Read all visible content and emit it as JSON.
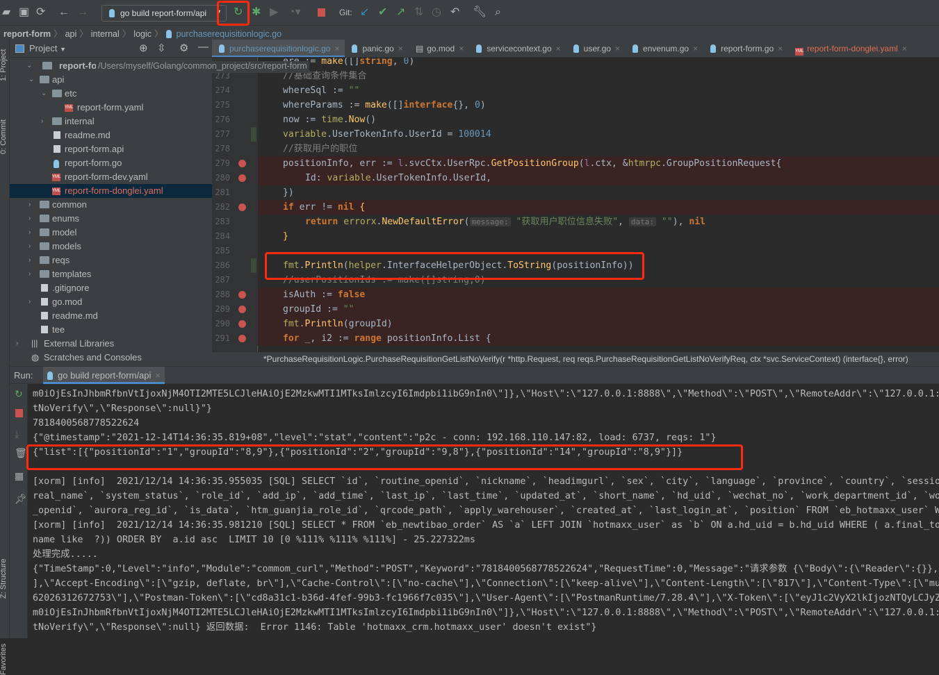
{
  "toolbar": {
    "run_config": "go build report-form/api",
    "git_label": "Git:",
    "icons": [
      "open-folder-icon",
      "save-icon",
      "sync-icon",
      "back-icon",
      "forward-icon",
      "rerun-icon",
      "debug-icon",
      "coverage-icon",
      "profile-icon",
      "stop-icon",
      "git-update-icon",
      "git-commit-icon",
      "git-push-icon",
      "git-compare-icon",
      "history-icon",
      "revert-icon",
      "settings-wrench-icon",
      "search-icon"
    ]
  },
  "breadcrumb": [
    "report-form",
    "api",
    "internal",
    "logic",
    "purchaserequisitionlogic.go"
  ],
  "left_strip": [
    "1: Project",
    "0: Commit",
    "Z: Structure",
    "Favorites"
  ],
  "project_panel": {
    "title": "Project",
    "root_path": "/Users/myself/Golang/common_project/src/report-form"
  },
  "tree": [
    {
      "name": "report-form",
      "level": 0,
      "type": "folder",
      "open": true,
      "root": true
    },
    {
      "name": "api",
      "level": 1,
      "type": "folder",
      "open": true
    },
    {
      "name": "etc",
      "level": 2,
      "type": "folder",
      "open": true
    },
    {
      "name": "report-form.yaml",
      "level": 3,
      "type": "yaml"
    },
    {
      "name": "internal",
      "level": 2,
      "type": "folder",
      "open": false
    },
    {
      "name": "readme.md",
      "level": 2,
      "type": "md"
    },
    {
      "name": "report-form.api",
      "level": 2,
      "type": "api"
    },
    {
      "name": "report-form.go",
      "level": 2,
      "type": "go"
    },
    {
      "name": "report-form-dev.yaml",
      "level": 2,
      "type": "yaml"
    },
    {
      "name": "report-form-donglei.yaml",
      "level": 2,
      "type": "yaml",
      "selected": true,
      "modified": true
    },
    {
      "name": "common",
      "level": 1,
      "type": "folder",
      "open": false
    },
    {
      "name": "enums",
      "level": 1,
      "type": "folder",
      "open": false
    },
    {
      "name": "model",
      "level": 1,
      "type": "folder",
      "open": false
    },
    {
      "name": "models",
      "level": 1,
      "type": "folder",
      "open": false
    },
    {
      "name": "reqs",
      "level": 1,
      "type": "folder",
      "open": false
    },
    {
      "name": "templates",
      "level": 1,
      "type": "folder",
      "open": false
    },
    {
      "name": ".gitignore",
      "level": 1,
      "type": "file"
    },
    {
      "name": "go.mod",
      "level": 1,
      "type": "file",
      "open": false
    },
    {
      "name": "readme.md",
      "level": 1,
      "type": "md"
    },
    {
      "name": "tee",
      "level": 1,
      "type": "file"
    },
    {
      "name": "External Libraries",
      "level": 0,
      "type": "lib",
      "open": false
    },
    {
      "name": "Scratches and Consoles",
      "level": 0,
      "type": "scratch"
    }
  ],
  "tabs": [
    {
      "label": "purchaserequisitionlogic.go",
      "icon": "go",
      "active": true
    },
    {
      "label": "panic.go",
      "icon": "go"
    },
    {
      "label": "go.mod",
      "icon": "file"
    },
    {
      "label": "servicecontext.go",
      "icon": "go"
    },
    {
      "label": "user.go",
      "icon": "go"
    },
    {
      "label": "envenum.go",
      "icon": "go"
    },
    {
      "label": "report-form.go",
      "icon": "go"
    },
    {
      "label": "report-form-donglei.yaml",
      "icon": "yaml",
      "modified": true
    }
  ],
  "code": [
    {
      "n": "",
      "indent": 1,
      "t": [
        [
          "ere := ",
          "p"
        ],
        [
          "make",
          "fn"
        ],
        [
          "([]",
          "p"
        ],
        [
          "string",
          "kw"
        ],
        [
          ", ",
          "p"
        ],
        [
          "0",
          "num"
        ],
        [
          ")",
          "p"
        ]
      ]
    },
    {
      "n": "273",
      "indent": 1,
      "t": [
        [
          "//基础查询条件集合",
          "cm"
        ]
      ]
    },
    {
      "n": "274",
      "indent": 1,
      "t": [
        [
          "whereSql := ",
          "p"
        ],
        [
          "\"\"",
          "str"
        ]
      ]
    },
    {
      "n": "275",
      "indent": 1,
      "t": [
        [
          "whereParams := ",
          "p"
        ],
        [
          "make",
          "fn"
        ],
        [
          "([]",
          "p"
        ],
        [
          "interface",
          "kw"
        ],
        [
          "{}, ",
          "p"
        ],
        [
          "0",
          "num"
        ],
        [
          ")",
          "p"
        ]
      ]
    },
    {
      "n": "276",
      "indent": 1,
      "t": [
        [
          "now := ",
          "p"
        ],
        [
          "time",
          "pk"
        ],
        [
          ".",
          "p"
        ],
        [
          "Now",
          "fn"
        ],
        [
          "()",
          "p"
        ]
      ]
    },
    {
      "n": "277",
      "indent": 1,
      "changed": true,
      "t": [
        [
          "variable",
          "pk"
        ],
        [
          ".UserTokenInfo.UserId = ",
          "p"
        ],
        [
          "100014",
          "num"
        ]
      ]
    },
    {
      "n": "278",
      "indent": 1,
      "t": [
        [
          "//获取用户的职位",
          "cm"
        ]
      ]
    },
    {
      "n": "279",
      "indent": 1,
      "bp": true,
      "t": [
        [
          "positionInfo, err := ",
          "p"
        ],
        [
          "l",
          "fld"
        ],
        [
          ".svcCtx.UserRpc.",
          "p"
        ],
        [
          "GetPositionGroup",
          "fn"
        ],
        [
          "(",
          "p"
        ],
        [
          "l",
          "fld"
        ],
        [
          ".ctx, &",
          "p"
        ],
        [
          "htmrpc",
          "pk"
        ],
        [
          ".GroupPositionRequest{",
          "p"
        ]
      ]
    },
    {
      "n": "280",
      "indent": 2,
      "bp": true,
      "t": [
        [
          "Id: ",
          "p"
        ],
        [
          "variable",
          "pk"
        ],
        [
          ".UserTokenInfo.UserId,",
          "p"
        ]
      ]
    },
    {
      "n": "281",
      "indent": 1,
      "t": [
        [
          "})",
          "p"
        ]
      ]
    },
    {
      "n": "282",
      "indent": 1,
      "bp": true,
      "t": [
        [
          "if ",
          "kw"
        ],
        [
          "err != ",
          "p"
        ],
        [
          "nil",
          "kw"
        ],
        [
          " {",
          "fn"
        ]
      ]
    },
    {
      "n": "283",
      "indent": 2,
      "t": [
        [
          "return ",
          "kw"
        ],
        [
          "errorx",
          "pk"
        ],
        [
          ".",
          "p"
        ],
        [
          "NewDefaultError",
          "fn"
        ],
        [
          "(",
          "p"
        ],
        [
          "message:",
          "hint"
        ],
        [
          " ",
          "p"
        ],
        [
          "\"获取用户职位信息失败\"",
          "str"
        ],
        [
          ", ",
          "p"
        ],
        [
          "data:",
          "hint"
        ],
        [
          " ",
          "p"
        ],
        [
          "\"\"",
          "str"
        ],
        [
          "), ",
          "p"
        ],
        [
          "nil",
          "kw"
        ]
      ]
    },
    {
      "n": "284",
      "indent": 1,
      "t": [
        [
          "}",
          "fn"
        ]
      ]
    },
    {
      "n": "285",
      "indent": 1,
      "t": []
    },
    {
      "n": "286",
      "indent": 1,
      "changed": true,
      "t": [
        [
          "fmt",
          "pk"
        ],
        [
          ".",
          "p"
        ],
        [
          "Println",
          "fn"
        ],
        [
          "(",
          "p"
        ],
        [
          "helper",
          "pk"
        ],
        [
          ".InterfaceHelperObject.",
          "p"
        ],
        [
          "ToString",
          "fn"
        ],
        [
          "(positionInfo))",
          "p"
        ]
      ]
    },
    {
      "n": "287",
      "indent": 1,
      "t": [
        [
          "//userPositionIds := make([]string,0)",
          "cm"
        ]
      ]
    },
    {
      "n": "288",
      "indent": 1,
      "bp": true,
      "t": [
        [
          "isAuth := ",
          "p"
        ],
        [
          "false",
          "kw"
        ]
      ]
    },
    {
      "n": "289",
      "indent": 1,
      "bp": true,
      "t": [
        [
          "groupId := ",
          "p"
        ],
        [
          "\"\"",
          "str"
        ]
      ]
    },
    {
      "n": "290",
      "indent": 1,
      "bp": true,
      "t": [
        [
          "fmt",
          "pk"
        ],
        [
          ".",
          "p"
        ],
        [
          "Println",
          "fn"
        ],
        [
          "(groupId)",
          "p"
        ]
      ]
    },
    {
      "n": "291",
      "indent": 1,
      "bp": true,
      "t": [
        [
          "for ",
          "kw"
        ],
        [
          "_, i2 := ",
          "p"
        ],
        [
          "range ",
          "kw"
        ],
        [
          "positionInfo.List {",
          "p"
        ]
      ]
    }
  ],
  "status_signature": "*PurchaseRequisitionLogic.PurchaseRequisitionGetListNoVerify(r *http.Request, req reqs.PurchaseRequisitionGetListNoVerifyReq, ctx *svc.ServiceContext) (interface{}, error)",
  "run": {
    "label": "Run:",
    "tab": "go build report-form/api"
  },
  "console_icons": [
    "rerun-icon",
    "stop-icon",
    "scroll-to-end-icon",
    "trash-icon",
    "layout-icon",
    "pin-icon"
  ],
  "console": [
    "m0iOjEsInJhbmRfbnVtIjoxNjM4OTI2MTE5LCJleHAiOjE2MzkwMTI1MTksImlzcyI6Imdpbi1ibG9nIn0\\\"]},\\\"Host\\\":\\\"127.0.0.1:8888\\\",\\\"Method\\\":\\\"POST\\\",\\\"RemoteAddr\\\":\\\"127.0.0.1:5",
    "tNoVerify\\\",\\\"Response\\\":null}\"}",
    "7818400568778522624",
    "{\"@timestamp\":\"2021-12-14T14:36:35.819+08\",\"level\":\"stat\",\"content\":\"p2c - conn: 192.168.110.147:82, load: 6737, reqs: 1\"}",
    "{\"list\":[{\"positionId\":\"1\",\"groupId\":\"8,9\"},{\"positionId\":\"2\",\"groupId\":\"9,8\"},{\"positionId\":\"14\",\"groupId\":\"8,9\"}]}",
    "",
    "[xorm] [info]  2021/12/14 14:36:35.955035 [SQL] SELECT `id`, `routine_openid`, `nickname`, `headimgurl`, `sex`, `city`, `language`, `province`, `country`, `session",
    "real_name`, `system_status`, `role_id`, `add_ip`, `add_time`, `last_ip`, `last_time`, `updated_at`, `short_name`, `hd_uid`, `wechat_no`, `work_department_id`, `wor",
    "_openid`, `aurora_reg_id`, `is_data`, `htm_guanjia_role_id`, `qrcode_path`, `apply_warehouser`, `created_at`, `last_login_at`, `position` FROM `eb_hotmaxx_user` WH",
    "[xorm] [info]  2021/12/14 14:36:35.981210 [SQL] SELECT * FROM `eb_newtibao_order` AS `a` LEFT JOIN `hotmaxx_user` as `b` ON a.hd_uid = b.hd_uid WHERE ( a.final_tot",
    "name like  ?)) ORDER BY  a.id asc  LIMIT 10 [0 %111% %111% %111%] - 25.227322ms",
    "处理完成.....",
    "{\"TimeStamp\":0,\"Level\":\"info\",\"Module\":\"commom_curl\",\"Method\":\"POST\",\"Keyword\":\"7818400568778522624\",\"RequestTime\":0,\"Message\":\"请求参数 {\\\"Body\\\":{\\\"Reader\\\":{}},",
    "],\\\"Accept-Encoding\\\":[\\\"gzip, deflate, br\\\"],\\\"Cache-Control\\\":[\\\"no-cache\\\"],\\\"Connection\\\":[\\\"keep-alive\\\"],\\\"Content-Length\\\":[\\\"817\\\"],\\\"Content-Type\\\":[\\\"mul",
    "62026312672753\\\"],\\\"Postman-Token\\\":[\\\"cd8a31c1-b36d-4fef-99b3-fc1966f7c035\\\"],\\\"User-Agent\\\":[\\\"PostmanRuntime/7.28.4\\\"],\\\"X-Token\\\":[\\\"eyJ1c2VyX2lkIjozNTQyLCJyZW",
    "m0iOjEsInJhbmRfbnVtIjoxNjM4OTI2MTE5LCJleHAiOjE2MzkwMTI1MTksImlzcyI6Imdpbi1ibG9nIn0\\\"]},\\\"Host\\\":\\\"127.0.0.1:8888\\\",\\\"Method\\\":\\\"POST\\\",\\\"RemoteAddr\\\":\\\"127.0.0.1:5",
    "tNoVerify\\\",\\\"Response\\\":null} 返回数据:  Error 1146: Table 'hotmaxx_crm.hotmaxx_user' doesn't exist\"}"
  ],
  "colors": {
    "annotation_box": "#ff2a10",
    "breakpoint": "#c75450",
    "active_tab_text": "#6897bb",
    "modified_file": "#e06c5a"
  }
}
